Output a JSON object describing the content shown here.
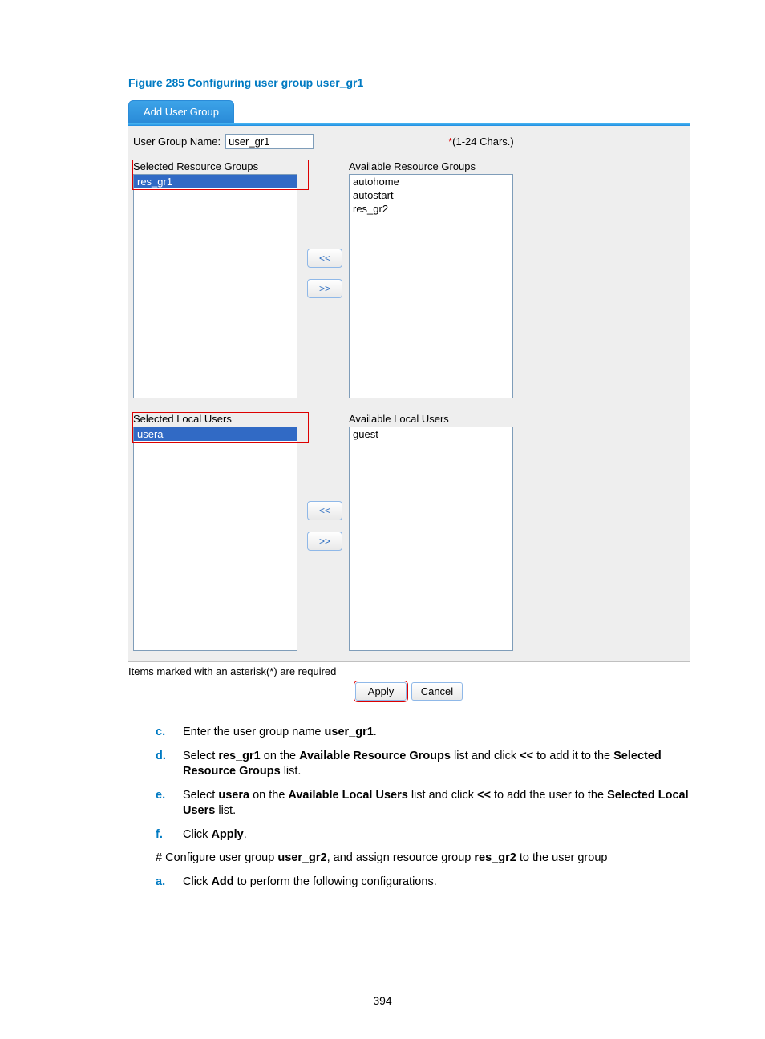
{
  "figure_caption": "Figure 285 Configuring user group user_gr1",
  "tab_label": "Add User Group",
  "group_name_label": "User Group Name:",
  "group_name_value": "user_gr1",
  "group_name_hint": "(1-24 Chars.)",
  "asterisk": "*",
  "dual1": {
    "left_title": "Selected Resource Groups",
    "left_items": [
      "res_gr1"
    ],
    "right_title": "Available Resource Groups",
    "right_items": [
      "autohome",
      "autostart",
      "res_gr2"
    ]
  },
  "dual2": {
    "left_title": "Selected Local Users",
    "left_items": [
      "usera"
    ],
    "right_title": "Available Local Users",
    "right_items": [
      "guest"
    ]
  },
  "move_left_label": "<<",
  "move_right_label": ">>",
  "required_note": "Items marked with an asterisk(*) are required",
  "apply_label": "Apply",
  "cancel_label": "Cancel",
  "steps": {
    "c": {
      "marker": "c.",
      "parts": [
        "Enter the user group name ",
        "user_gr1",
        "."
      ]
    },
    "d": {
      "marker": "d.",
      "parts": [
        "Select ",
        "res_gr1",
        " on the ",
        "Available Resource Groups",
        " list and click ",
        "<<",
        " to add it to the ",
        "Selected Resource Groups",
        " list."
      ]
    },
    "e": {
      "marker": "e.",
      "parts": [
        "Select ",
        "usera",
        " on the ",
        "Available Local Users",
        " list and click ",
        "<<",
        " to add the user to the ",
        "Selected Local Users",
        " list."
      ]
    },
    "f": {
      "marker": "f.",
      "parts": [
        "Click ",
        "Apply",
        "."
      ]
    }
  },
  "para1_parts": [
    "# Configure user group ",
    "user_gr2",
    ", and assign resource group ",
    "res_gr2",
    " to the user group"
  ],
  "step_a": {
    "marker": "a.",
    "parts": [
      "Click ",
      "Add",
      " to perform the following configurations."
    ]
  },
  "page_number": "394"
}
